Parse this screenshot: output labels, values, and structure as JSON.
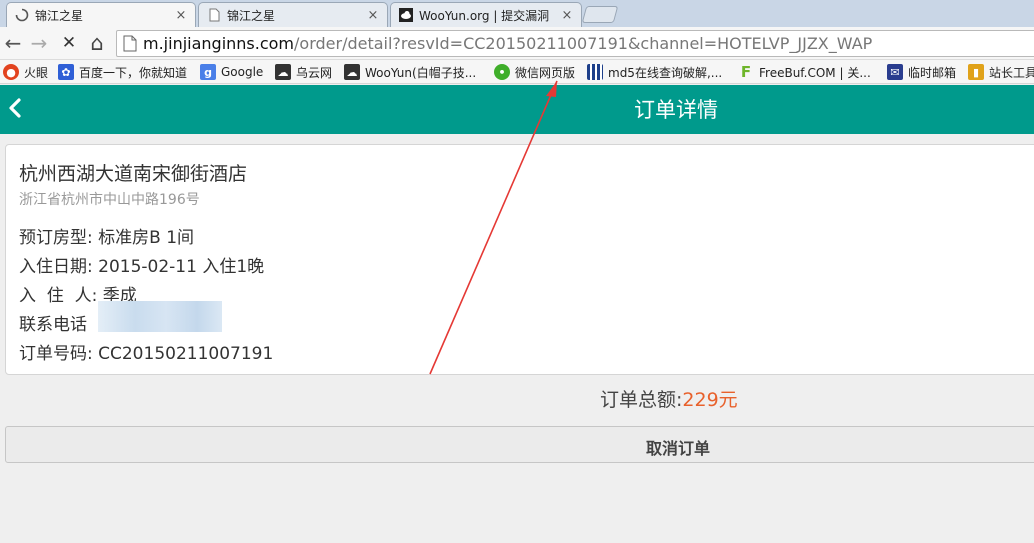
{
  "browser": {
    "tabs": [
      {
        "title": "锦江之星",
        "active": true,
        "close": "×"
      },
      {
        "title": "锦江之星",
        "active": false,
        "close": "×"
      },
      {
        "title": "WooYun.org | 提交漏洞",
        "active": false,
        "close": "×"
      }
    ],
    "address": {
      "host": "m.jinjianginns.com",
      "path": "/order/detail?resvId=CC20150211007191&channel=HOTELVP_JJZX_WAP"
    },
    "nav": {
      "back": "←",
      "forward": "→",
      "stop": "✕",
      "home": "⌂"
    },
    "bookmarks": [
      {
        "label": "火眼",
        "icon": "fire-eye-icon",
        "color": "#e2431f"
      },
      {
        "label": "百度一下，你就知道",
        "icon": "baidu-paw-icon",
        "color": "#2f5fd6"
      },
      {
        "label": "Google",
        "icon": "google-icon",
        "color": "#4a7fe8"
      },
      {
        "label": "乌云网",
        "icon": "wooyun-cloud-icon",
        "color": "#333333"
      },
      {
        "label": "WooYun(白帽子技...",
        "icon": "wooyun-cloud-icon",
        "color": "#333333"
      },
      {
        "label": "微信网页版",
        "icon": "wechat-icon",
        "color": "#3fae2a"
      },
      {
        "label": "md5在线查询破解,...",
        "icon": "md5-grid-icon",
        "color": "#1d3f8a"
      },
      {
        "label": "FreeBuf.COM | 关...",
        "icon": "freebuf-icon",
        "color": "#6eb52a"
      },
      {
        "label": "临时邮箱",
        "icon": "mail-icon",
        "color": "#2a3d8f"
      },
      {
        "label": "站长工具",
        "icon": "chinaz-icon",
        "color": "#e0a21a"
      }
    ]
  },
  "header": {
    "title": "订单详情",
    "back_icon": "chevron-left-icon"
  },
  "order": {
    "hotel_name": "杭州西湖大道南宋御街酒店",
    "hotel_address": "浙江省杭州市中山中路196号",
    "room_type": "预订房型: 标准房B 1间",
    "checkin": "入住日期: 2015-02-11 入住1晚",
    "guest": "入  住  人: 季成",
    "phone_label": "联系电话",
    "order_no": "订单号码: CC20150211007191"
  },
  "summary": {
    "total_label": "订单总额:",
    "total_amount": "229元"
  },
  "actions": {
    "cancel_label": "取消订单"
  },
  "colors": {
    "header": "#009a8c",
    "amount": "#e8612c",
    "annotation": "#e53935"
  }
}
